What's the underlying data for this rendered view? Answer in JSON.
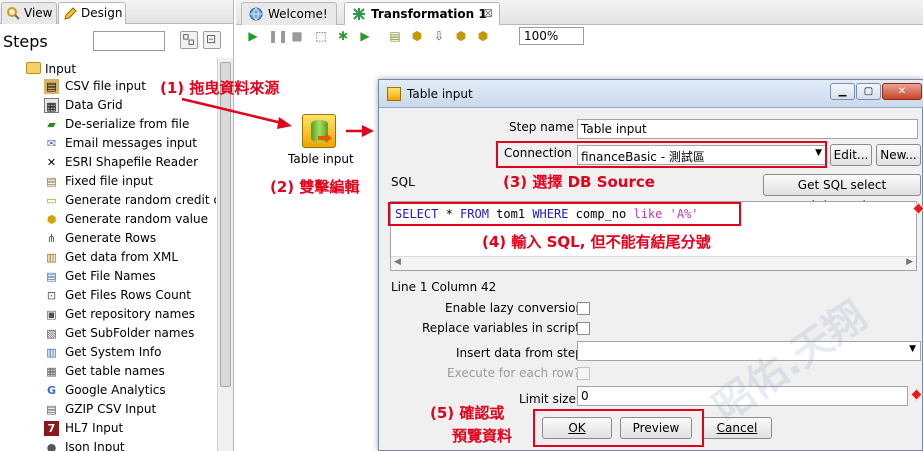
{
  "left_panel": {
    "tab_view": "View",
    "tab_design": "Design",
    "steps_label": "Steps",
    "category": "Input",
    "items": [
      {
        "label": "CSV file input",
        "icon": "csv-file-icon"
      },
      {
        "label": "Data Grid",
        "icon": "data-grid-icon"
      },
      {
        "label": "De-serialize from file",
        "icon": "deserialize-icon"
      },
      {
        "label": "Email messages input",
        "icon": "email-icon"
      },
      {
        "label": "ESRI Shapefile Reader",
        "icon": "esri-icon"
      },
      {
        "label": "Fixed file input",
        "icon": "fixed-file-icon"
      },
      {
        "label": "Generate random credit ca",
        "icon": "credit-card-icon"
      },
      {
        "label": "Generate random value",
        "icon": "random-value-icon"
      },
      {
        "label": "Generate Rows",
        "icon": "generate-rows-icon"
      },
      {
        "label": "Get data from XML",
        "icon": "xml-icon"
      },
      {
        "label": "Get File Names",
        "icon": "file-names-icon"
      },
      {
        "label": "Get Files Rows Count",
        "icon": "files-rows-count-icon"
      },
      {
        "label": "Get repository names",
        "icon": "repository-icon"
      },
      {
        "label": "Get SubFolder names",
        "icon": "subfolder-icon"
      },
      {
        "label": "Get System Info",
        "icon": "system-info-icon"
      },
      {
        "label": "Get table names",
        "icon": "table-names-icon"
      },
      {
        "label": "Google Analytics",
        "icon": "google-icon"
      },
      {
        "label": "GZIP CSV Input",
        "icon": "gzip-icon"
      },
      {
        "label": "HL7 Input",
        "icon": "hl7-icon"
      },
      {
        "label": "Json Input",
        "icon": "json-icon"
      }
    ]
  },
  "editor": {
    "tab_welcome": "Welcome!",
    "tab_transformation": "Transformation 1",
    "tab_close": "⊠",
    "zoom": "100%",
    "step_label": "Table input"
  },
  "annotations": {
    "a1": "(1) 拖曳資料來源",
    "a2": "(2) 雙擊編輯",
    "a3": "(3) 選擇 DB Source",
    "a4": "(4) 輸入 SQL, 但不能有結尾分號",
    "a5_line1": "(5) 確認或",
    "a5_line2": "預覽資料",
    "watermark": "昭佑.天翔"
  },
  "dialog": {
    "title": "Table input",
    "step_name_label": "Step name",
    "step_name_value": "Table input",
    "connection_label": "Connection",
    "connection_value": "financeBasic - 測試區",
    "edit_button": "Edit...",
    "new_button": "New...",
    "sql_label": "SQL",
    "get_sql_button": "Get SQL select statement...",
    "sql": {
      "t1": "SELECT",
      "t2": " * ",
      "t3": "FROM",
      "t4": " tom1 ",
      "t5": "WHERE",
      "t6": " comp_no ",
      "t7": "like",
      "t8": " ",
      "t9": "'A%'"
    },
    "position": "Line 1 Column 42",
    "lazy_label": "Enable lazy conversion",
    "replace_label": "Replace variables in script?",
    "insert_label": "Insert data from step",
    "each_row_label": "Execute for each row?",
    "limit_label": "Limit size",
    "limit_value": "0",
    "ok_button": "OK",
    "preview_button": "Preview",
    "cancel_button": "Cancel"
  },
  "colors": {
    "annotation": "#e3001b",
    "sql_keyword": "#1c1cbf",
    "sql_string": "#c03ab3"
  }
}
